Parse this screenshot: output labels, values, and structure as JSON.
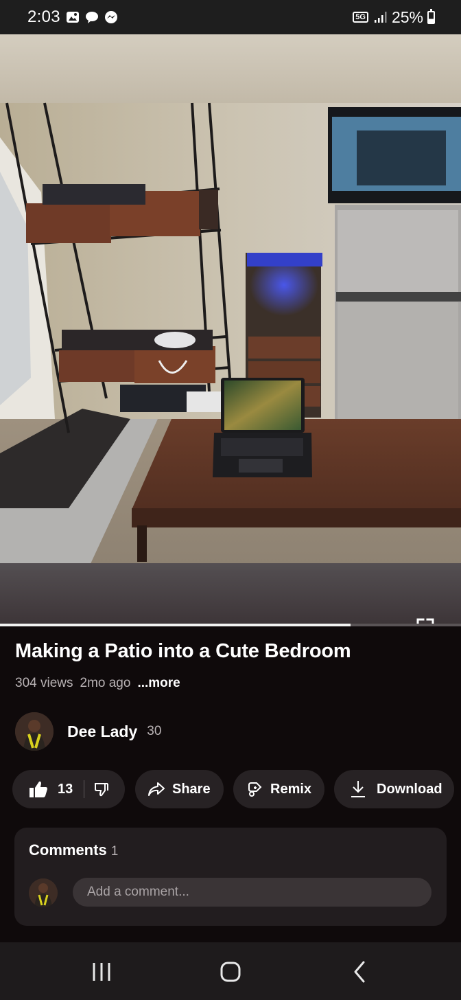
{
  "status_bar": {
    "time": "2:03",
    "network": "5G",
    "battery": "25%",
    "icons": [
      "gallery-icon",
      "chat-bubble-icon",
      "messenger-icon",
      "signal-icon",
      "battery-icon"
    ]
  },
  "video": {
    "progress": 0.76,
    "fullscreen_icon": "fullscreen-icon"
  },
  "info": {
    "title": "Making a Patio into a Cute Bedroom",
    "views": "304 views",
    "age": "2mo ago",
    "more": "...more"
  },
  "channel": {
    "name": "Dee Lady",
    "subscribers": "30"
  },
  "actions": {
    "like_count": "13",
    "share": "Share",
    "remix": "Remix",
    "download": "Download"
  },
  "comments": {
    "label": "Comments",
    "count": "1",
    "placeholder": "Add a comment..."
  },
  "nav": {
    "icons": [
      "recents-icon",
      "home-icon",
      "back-icon"
    ]
  },
  "colors": {
    "background": "#0f0a0b",
    "pill": "#272224",
    "panel": "#221d1f",
    "accent_light": "#3f52ff"
  }
}
